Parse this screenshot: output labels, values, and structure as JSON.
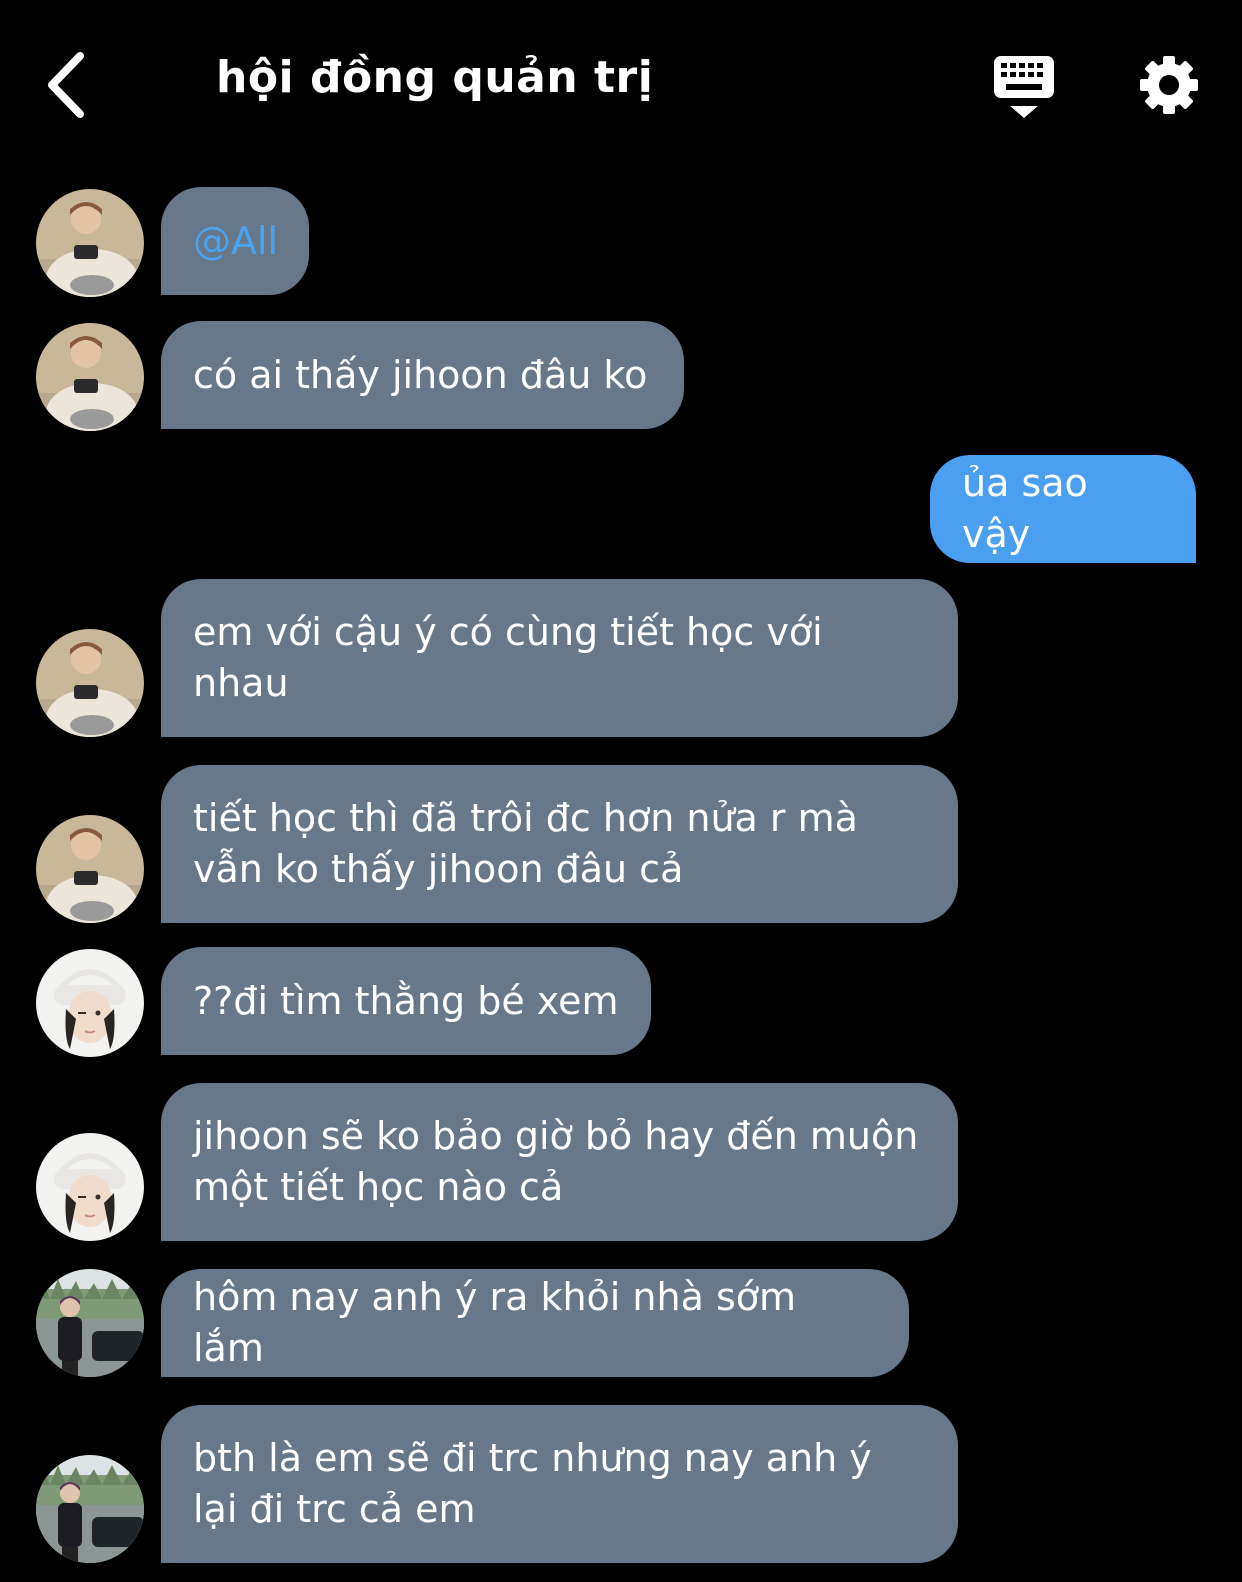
{
  "header": {
    "title": "hội đồng quản trị"
  },
  "colors": {
    "background": "#000000",
    "incoming_bubble": "#66788a",
    "outgoing_bubble": "#4a9ff0",
    "mention": "#4aa3f0",
    "text": "#ffffff"
  },
  "icons": {
    "back": "chevron-left-icon",
    "keyboard": "keyboard-icon",
    "settings": "gear-icon"
  },
  "messages": [
    {
      "sender": "user1",
      "text": "@All"
    },
    {
      "sender": "user1",
      "text": "có ai thấy jihoon đâu ko"
    },
    {
      "sender": "me",
      "text": "ủa sao vậy"
    },
    {
      "sender": "user1",
      "text": "em với cậu ý có cùng tiết học với nhau"
    },
    {
      "sender": "user1",
      "text": "tiết học thì đã trôi đc hơn nửa r mà vẫn ko thấy jihoon đâu cả"
    },
    {
      "sender": "user2",
      "text": "??đi tìm thằng bé xem"
    },
    {
      "sender": "user2",
      "text": "jihoon sẽ ko bảo giờ bỏ hay đến muộn một tiết học nào cả"
    },
    {
      "sender": "user3",
      "text": "hôm nay anh ý ra khỏi nhà sớm lắm"
    },
    {
      "sender": "user3",
      "text": "bth là em sẽ đi trc nhưng nay anh ý lại đi trc cả em"
    }
  ]
}
